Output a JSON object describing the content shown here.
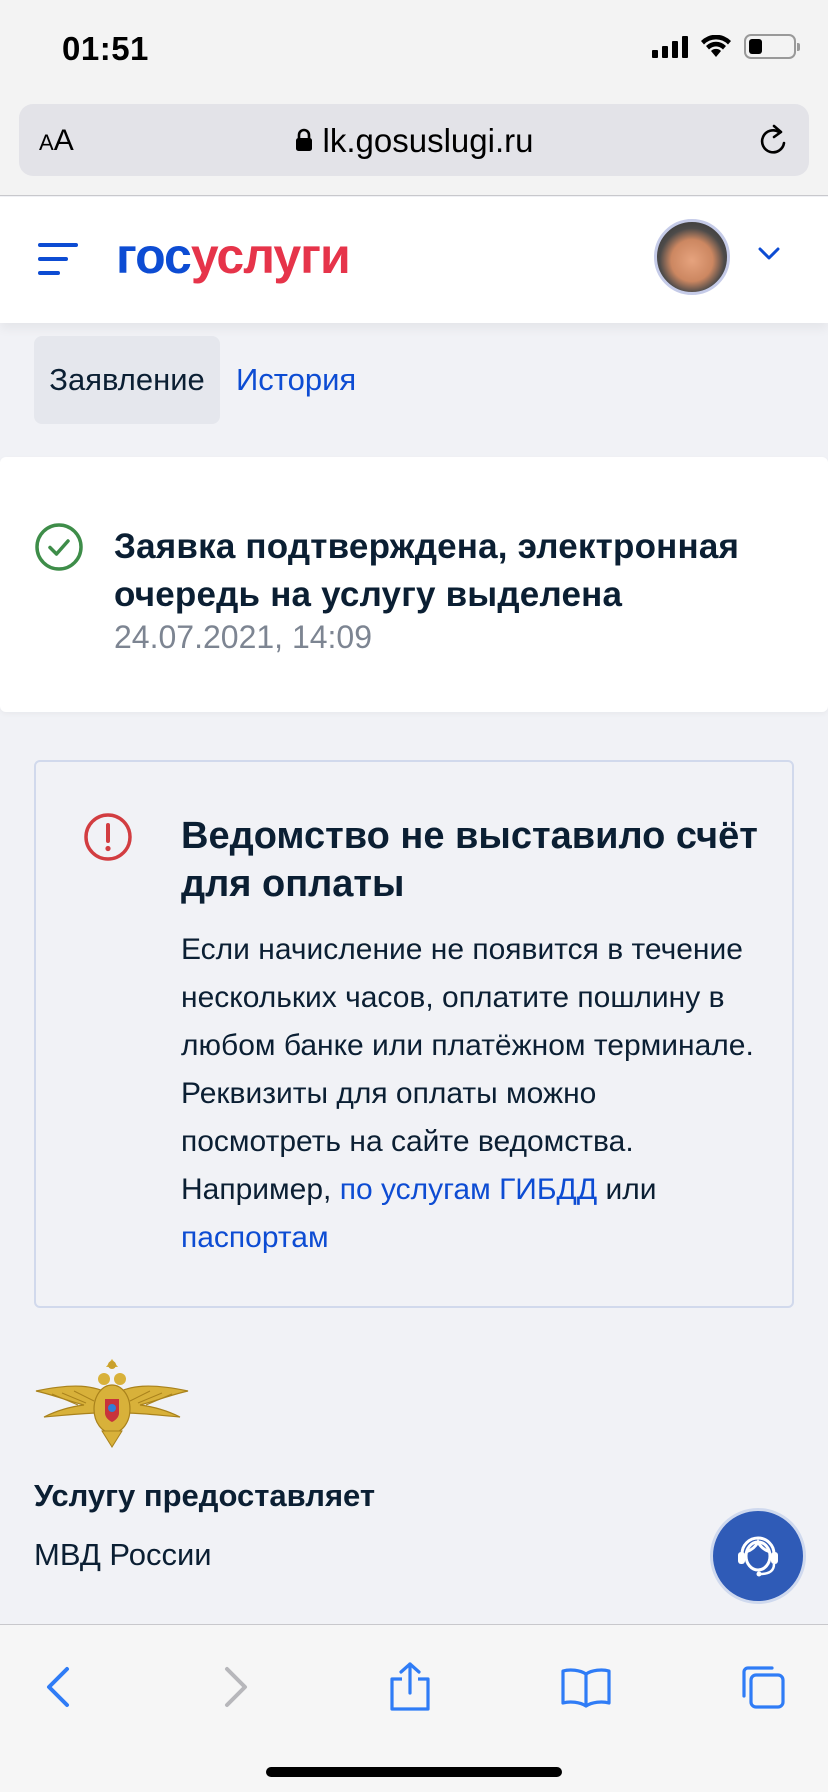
{
  "status_bar": {
    "time": "01:51"
  },
  "browser": {
    "text_size_small": "A",
    "text_size_large": "A",
    "url": "lk.gosuslugi.ru"
  },
  "header": {
    "logo_part1": "гос",
    "logo_part2": "услуги"
  },
  "tabs": [
    {
      "label": "Заявление",
      "active": true
    },
    {
      "label": "История",
      "active": false
    }
  ],
  "status_card": {
    "title": "Заявка подтверждена, электронная очередь на услугу выделена",
    "date": "24.07.2021, 14:09"
  },
  "warning": {
    "title": "Ведомство не выставило счёт для оплаты",
    "body_text": "Если начисление не появится в течение нескольких часов, оплатите пошлину в любом банке или платёжном терминале. Реквизиты для оплаты можно посмотреть на сайте ведомства. Например, ",
    "link1": "по услугам ГИБДД",
    "conjunction": " или ",
    "link2": "паспортам"
  },
  "provider": {
    "label": "Услугу предоставляет",
    "name": "МВД России"
  },
  "colors": {
    "accent": "#0d4cd3",
    "brand_red": "#e6344a",
    "success": "#3e8d49",
    "error": "#d23d41"
  },
  "icons": [
    "menu-icon",
    "chevron-down-icon",
    "check-circle-icon",
    "exclamation-circle-icon",
    "emblem-icon",
    "support-icon",
    "back-icon",
    "forward-icon",
    "share-icon",
    "bookmarks-icon",
    "tabs-icon",
    "lock-icon",
    "reload-icon"
  ]
}
